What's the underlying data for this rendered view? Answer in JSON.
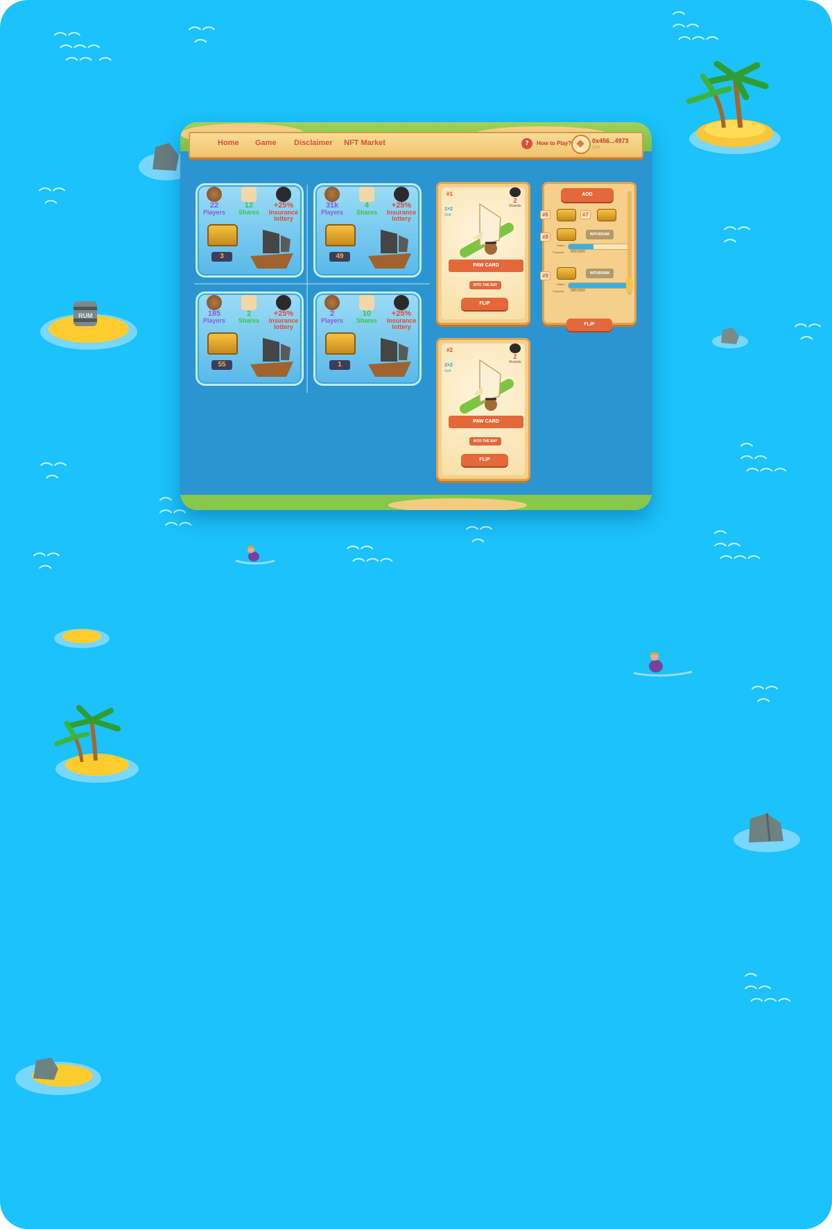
{
  "nav": {
    "links": [
      "Home",
      "Game",
      "Disclaimer",
      "NFT Market"
    ],
    "help": "How to Play?",
    "help_icon": "?",
    "wallet_address": "0x456...4973",
    "wallet_sub": "Quit"
  },
  "pools": [
    {
      "players": "22",
      "shares": "12",
      "lottery": "+25%",
      "chests": "3"
    },
    {
      "players": "31k",
      "shares": "4",
      "lottery": "+25%",
      "chests": "49"
    },
    {
      "players": "185",
      "shares": "2",
      "lottery": "+25%",
      "chests": "55"
    },
    {
      "players": "2",
      "shares": "10",
      "lottery": "+25%",
      "chests": "1"
    }
  ],
  "pool_labels": {
    "players": "Players",
    "shares": "Shares",
    "lottery": "Insurance lottery"
  },
  "cards": [
    {
      "id": "#1",
      "grid": "1×2",
      "grid_label": "Grid",
      "rounds": "2",
      "rounds_label": "Rounds",
      "ribbon": "PAW CARD",
      "into": "INTO THE BAY",
      "flip": "FLIP"
    },
    {
      "id": "#2",
      "grid": "2×2",
      "grid_label": "Grid",
      "rounds": "2",
      "rounds_label": "Rounds",
      "ribbon": "PAW CARD",
      "into": "INTO THE BAY",
      "flip": "FLIP"
    }
  ],
  "panel": {
    "add": "ADD",
    "slots": [
      {
        "id": "#6"
      },
      {
        "id": "#7"
      },
      {
        "id": "#8",
        "withdraw": "WITHDRAW",
        "status_label": "Status",
        "progress_label": "Progress",
        "progress": "400/1000",
        "fill": 0.4
      },
      {
        "id": "#9",
        "withdraw": "WITHDRAW",
        "status_label": "Status",
        "progress_label": "Progress",
        "progress": "980/1000",
        "fill": 0.98
      }
    ],
    "flip": "FLIP"
  },
  "icons": {
    "players": "bear-icon",
    "shares": "map-icon",
    "lottery": "bomb-icon",
    "chest": "treasure-chest-icon",
    "ship": "pirate-ship-icon",
    "wallet": "bnb-icon"
  },
  "colors": {
    "sea": "#1bc2fb",
    "accent": "#e4683a",
    "parchment": "#f5d08c"
  }
}
